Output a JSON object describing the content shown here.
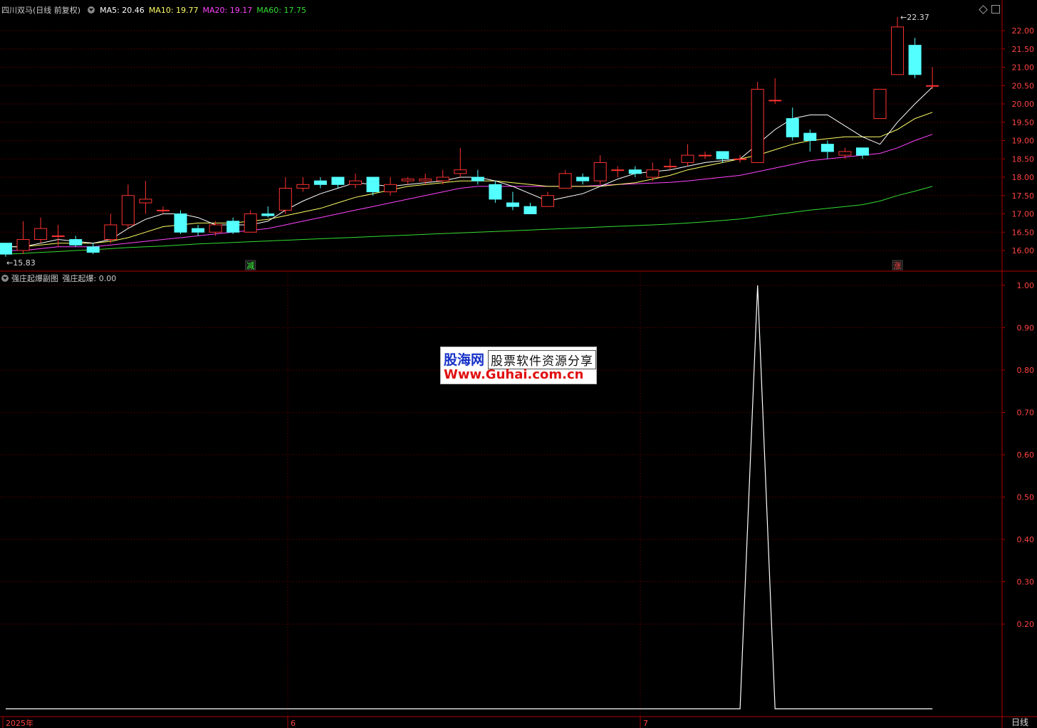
{
  "header": {
    "stock_name": "四川双马",
    "period": "(日线 前复权)",
    "ma_labels": [
      {
        "text": "MA5: 20.46",
        "color": "#ffffff"
      },
      {
        "text": "MA10: 19.77",
        "color": "#ffff66"
      },
      {
        "text": "MA20: 19.17",
        "color": "#ff44ff"
      },
      {
        "text": "MA60: 17.75",
        "color": "#33dd33"
      }
    ]
  },
  "sub_header": {
    "indicator_name": "强庄起爆副图",
    "value_label": "强庄起爆: 0.00"
  },
  "period_button": "日线",
  "watermark": {
    "line1_brand": "股海网",
    "line1_tag": "股票软件资源分享",
    "line2": "Www.Guhai.com.cn"
  },
  "colors": {
    "up": "#ff3232",
    "down": "#54ffff",
    "axis": "#b00000",
    "grid": "#7a0000",
    "ma5": "#ffffff",
    "ma10": "#ffff66",
    "ma20": "#ff44ff",
    "ma60": "#33dd33"
  },
  "icons": {
    "dropdown": "chevron-down-circle-icon",
    "restore": "diamond-icon",
    "window": "window-icon"
  },
  "chart_data": [
    {
      "type": "candlestick",
      "ylim": [
        15.8,
        22.3
      ],
      "yticks": [
        "22.00",
        "21.50",
        "21.00",
        "20.50",
        "20.00",
        "19.50",
        "19.00",
        "18.50",
        "18.00",
        "17.50",
        "17.00",
        "16.50",
        "16.00"
      ],
      "xticks": [
        "2025年",
        "6",
        "7"
      ],
      "high_marker": "22.37",
      "low_marker": "15.83",
      "markers": [
        {
          "index": 14,
          "text": "减",
          "color": "#33ff33"
        },
        {
          "index": 51,
          "text": "涨",
          "color": "#ff4444"
        }
      ],
      "candles": [
        [
          16.2,
          15.9,
          16.2,
          15.83
        ],
        [
          16.0,
          16.3,
          16.8,
          15.9
        ],
        [
          16.3,
          16.6,
          16.9,
          16.2
        ],
        [
          16.4,
          16.4,
          16.7,
          16.1
        ],
        [
          16.3,
          16.15,
          16.4,
          16.1
        ],
        [
          16.1,
          15.95,
          16.2,
          15.9
        ],
        [
          16.3,
          16.7,
          17.0,
          16.2
        ],
        [
          16.7,
          17.5,
          17.8,
          16.6
        ],
        [
          17.3,
          17.4,
          17.9,
          17.0
        ],
        [
          17.1,
          17.1,
          17.2,
          17.0
        ],
        [
          17.0,
          16.5,
          17.1,
          16.45
        ],
        [
          16.6,
          16.5,
          16.7,
          16.4
        ],
        [
          16.5,
          16.7,
          16.8,
          16.4
        ],
        [
          16.8,
          16.5,
          16.9,
          16.45
        ],
        [
          16.5,
          17.0,
          17.1,
          16.5
        ],
        [
          17.0,
          16.95,
          17.2,
          16.9
        ],
        [
          17.1,
          17.7,
          18.0,
          17.0
        ],
        [
          17.7,
          17.8,
          18.0,
          17.6
        ],
        [
          17.9,
          17.8,
          18.0,
          17.7
        ],
        [
          18.0,
          17.8,
          18.0,
          17.7
        ],
        [
          17.8,
          17.9,
          18.1,
          17.7
        ],
        [
          18.0,
          17.6,
          18.0,
          17.5
        ],
        [
          17.6,
          17.8,
          18.0,
          17.5
        ],
        [
          17.9,
          17.95,
          18.0,
          17.8
        ],
        [
          17.9,
          17.95,
          18.1,
          17.8
        ],
        [
          17.9,
          18.0,
          18.2,
          17.8
        ],
        [
          18.1,
          18.2,
          18.8,
          18.0
        ],
        [
          18.0,
          17.9,
          18.2,
          17.8
        ],
        [
          17.8,
          17.4,
          17.9,
          17.3
        ],
        [
          17.3,
          17.2,
          17.6,
          17.1
        ],
        [
          17.2,
          17.0,
          17.3,
          17.0
        ],
        [
          17.2,
          17.5,
          17.6,
          17.2
        ],
        [
          17.7,
          18.1,
          18.2,
          17.7
        ],
        [
          18.0,
          17.9,
          18.1,
          17.8
        ],
        [
          17.9,
          18.4,
          18.6,
          17.8
        ],
        [
          18.2,
          18.2,
          18.3,
          18.0
        ],
        [
          18.2,
          18.1,
          18.3,
          18.0
        ],
        [
          18.0,
          18.2,
          18.4,
          17.9
        ],
        [
          18.3,
          18.3,
          18.5,
          18.2
        ],
        [
          18.4,
          18.6,
          18.9,
          18.3
        ],
        [
          18.6,
          18.6,
          18.7,
          18.5
        ],
        [
          18.7,
          18.5,
          18.7,
          18.4
        ],
        [
          18.5,
          18.5,
          18.6,
          18.4
        ],
        [
          18.4,
          20.4,
          20.6,
          18.4
        ],
        [
          20.1,
          20.1,
          20.7,
          20.0
        ],
        [
          19.6,
          19.1,
          19.9,
          19.0
        ],
        [
          19.2,
          19.0,
          19.3,
          18.7
        ],
        [
          18.9,
          18.7,
          19.0,
          18.5
        ],
        [
          18.6,
          18.7,
          18.8,
          18.5
        ],
        [
          18.8,
          18.6,
          18.8,
          18.5
        ],
        [
          19.6,
          20.4,
          20.4,
          19.6
        ],
        [
          20.8,
          22.1,
          22.37,
          20.8
        ],
        [
          21.6,
          20.8,
          21.8,
          20.7
        ],
        [
          20.5,
          20.5,
          21.0,
          20.4
        ]
      ],
      "ma": {
        "ma5": [
          16.1,
          16.1,
          16.2,
          16.3,
          16.25,
          16.2,
          16.3,
          16.6,
          16.85,
          17.0,
          17.0,
          16.9,
          16.7,
          16.7,
          16.7,
          16.8,
          17.1,
          17.35,
          17.55,
          17.7,
          17.85,
          17.8,
          17.75,
          17.8,
          17.85,
          17.9,
          18.0,
          18.0,
          17.9,
          17.75,
          17.55,
          17.35,
          17.45,
          17.55,
          17.75,
          17.95,
          18.1,
          18.15,
          18.2,
          18.3,
          18.4,
          18.45,
          18.5,
          18.9,
          19.3,
          19.6,
          19.7,
          19.7,
          19.4,
          19.1,
          18.9,
          19.5,
          20.0,
          20.46
        ],
        "ma10": [
          16.1,
          16.1,
          16.15,
          16.2,
          16.2,
          16.2,
          16.25,
          16.35,
          16.5,
          16.65,
          16.7,
          16.75,
          16.75,
          16.75,
          16.8,
          16.85,
          16.95,
          17.05,
          17.15,
          17.3,
          17.45,
          17.55,
          17.65,
          17.75,
          17.8,
          17.85,
          17.9,
          17.9,
          17.9,
          17.85,
          17.8,
          17.75,
          17.75,
          17.75,
          17.75,
          17.8,
          17.85,
          17.95,
          18.05,
          18.2,
          18.3,
          18.4,
          18.5,
          18.6,
          18.75,
          18.9,
          19.0,
          19.05,
          19.1,
          19.1,
          19.1,
          19.3,
          19.6,
          19.77
        ],
        "ma20": [
          16.0,
          16.0,
          16.05,
          16.1,
          16.1,
          16.1,
          16.15,
          16.2,
          16.25,
          16.3,
          16.35,
          16.4,
          16.45,
          16.5,
          16.55,
          16.6,
          16.7,
          16.8,
          16.9,
          17.0,
          17.1,
          17.2,
          17.3,
          17.4,
          17.5,
          17.6,
          17.7,
          17.75,
          17.75,
          17.75,
          17.75,
          17.75,
          17.75,
          17.75,
          17.78,
          17.8,
          17.82,
          17.84,
          17.86,
          17.9,
          17.95,
          18.0,
          18.05,
          18.15,
          18.25,
          18.35,
          18.45,
          18.5,
          18.55,
          18.6,
          18.65,
          18.8,
          19.0,
          19.17
        ],
        "ma60": [
          15.9,
          15.92,
          15.95,
          15.97,
          16.0,
          16.02,
          16.05,
          16.08,
          16.1,
          16.12,
          16.15,
          16.18,
          16.2,
          16.22,
          16.24,
          16.26,
          16.28,
          16.3,
          16.32,
          16.34,
          16.36,
          16.38,
          16.4,
          16.42,
          16.44,
          16.46,
          16.48,
          16.5,
          16.52,
          16.54,
          16.56,
          16.58,
          16.6,
          16.62,
          16.64,
          16.66,
          16.68,
          16.7,
          16.72,
          16.75,
          16.78,
          16.82,
          16.86,
          16.92,
          16.98,
          17.04,
          17.1,
          17.15,
          17.2,
          17.25,
          17.35,
          17.5,
          17.62,
          17.75
        ]
      }
    },
    {
      "type": "line",
      "ylim": [
        0,
        1
      ],
      "yticks": [
        "1.00",
        "0.90",
        "0.80",
        "0.70",
        "0.60",
        "0.50",
        "0.40",
        "0.30",
        "0.20"
      ],
      "values": [
        0,
        0,
        0,
        0,
        0,
        0,
        0,
        0,
        0,
        0,
        0,
        0,
        0,
        0,
        0,
        0,
        0,
        0,
        0,
        0,
        0,
        0,
        0,
        0,
        0,
        0,
        0,
        0,
        0,
        0,
        0,
        0,
        0,
        0,
        0,
        0,
        0,
        0,
        0,
        0,
        0,
        0,
        0,
        1,
        0,
        0,
        0,
        0,
        0,
        0,
        0,
        0,
        0,
        0
      ]
    }
  ]
}
